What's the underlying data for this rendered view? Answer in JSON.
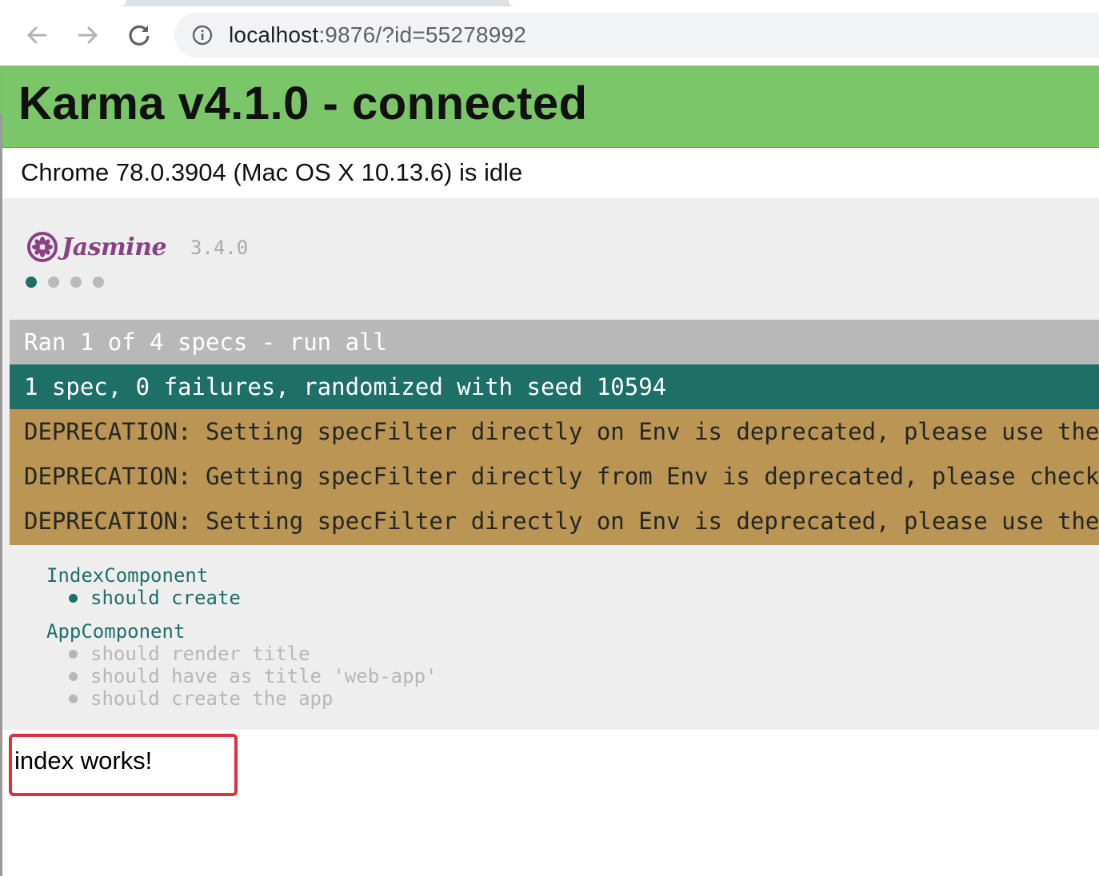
{
  "browser": {
    "url_host": "localhost",
    "url_rest": ":9876/?id=55278992"
  },
  "karma": {
    "title": "Karma v4.1.0 - connected",
    "browser_status": "Chrome 78.0.3904 (Mac OS X 10.13.6) is idle",
    "banner_color": "#7cc66a"
  },
  "jasmine": {
    "name": "Jasmine",
    "version": "3.4.0",
    "spec_dots": [
      "passed",
      "excluded",
      "excluded",
      "excluded"
    ],
    "ran_text": "Ran 1 of 4 specs - run all",
    "summary_text": "1 spec, 0 failures, randomized with seed 10594",
    "warnings": [
      "DEPRECATION: Setting specFilter directly on Env is deprecated, please use the sp",
      "DEPRECATION: Getting specFilter directly from Env is deprecated, please check th",
      "DEPRECATION: Setting specFilter directly on Env is deprecated, please use the sp"
    ],
    "suites": [
      {
        "title": "IndexComponent",
        "specs": [
          {
            "label": "should create",
            "status": "passed"
          }
        ]
      },
      {
        "title": "AppComponent",
        "specs": [
          {
            "label": "should render title",
            "status": "excluded"
          },
          {
            "label": "should have as title 'web-app'",
            "status": "excluded"
          },
          {
            "label": "should create the app",
            "status": "excluded"
          }
        ]
      }
    ],
    "colors": {
      "passed": "#1f6f69",
      "excluded": "#b7b7b7",
      "warning": "#ba9553"
    }
  },
  "output": {
    "text": "index works!",
    "highlight_color": "#e0303a"
  }
}
